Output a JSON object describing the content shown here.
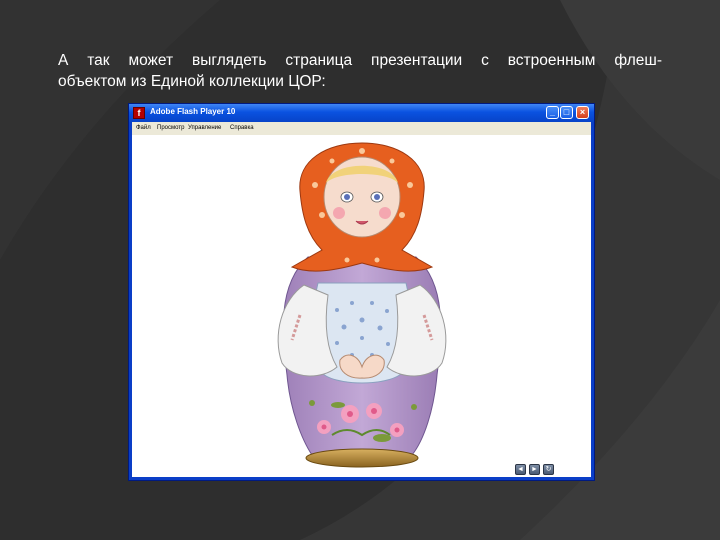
{
  "slide": {
    "line1": "А так может выглядеть страница презентации с встроенным флеш-",
    "line2": "объектом из Единой коллекции ЦОР:",
    "background": "#2e2e2e",
    "text_color": "#ffffff"
  },
  "window": {
    "title": "Adobe Flash Player 10",
    "menu": [
      "Файл",
      "Просмотр",
      "Управление",
      "Справка"
    ],
    "controls": {
      "minimize": "_",
      "maximize": "□",
      "close": "×"
    },
    "titlebar_color": "#0a52e0",
    "menubar_color": "#ece9d8"
  },
  "player_nav": {
    "prev": "◄",
    "next": "►",
    "reload": "↻"
  },
  "matryoshka": {
    "scarf_color": "#e65f1f",
    "dress_color": "#a88ac0",
    "apron_color": "#dce6f2",
    "sleeve_color": "#f2f2f2",
    "base_color": "#b0852e"
  }
}
